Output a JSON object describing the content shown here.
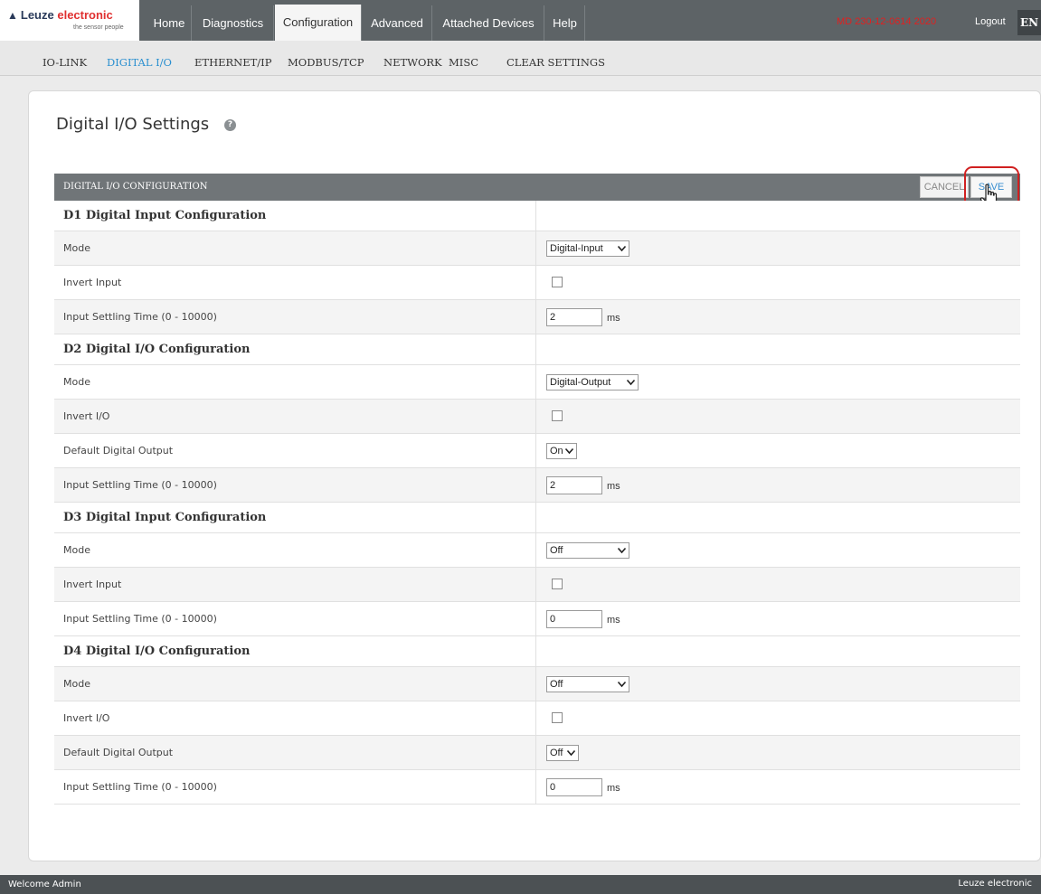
{
  "logo": {
    "brand_prefix": "Leuze ",
    "brand_accent": "electronic",
    "tagline": "the sensor people",
    "icon": "warning-triangle-icon"
  },
  "nav": {
    "tabs": [
      {
        "label": "Home",
        "active": false
      },
      {
        "label": "Diagnostics",
        "active": false
      },
      {
        "label": "Configuration",
        "active": true
      },
      {
        "label": "Advanced",
        "active": false
      },
      {
        "label": "Attached Devices",
        "active": false
      },
      {
        "label": "Help",
        "active": false
      }
    ],
    "serial": "MD 230-12-0614 2020",
    "logout": "Logout",
    "language": "EN"
  },
  "subnav": {
    "items": [
      {
        "label": "IO-LINK",
        "active": false
      },
      {
        "label": "DIGITAL I/O",
        "active": true
      },
      {
        "label": "ETHERNET/IP",
        "active": false
      },
      {
        "label": "MODBUS/TCP",
        "active": false
      },
      {
        "label": "NETWORK",
        "active": false
      },
      {
        "label": "MISC",
        "active": false
      },
      {
        "label": "CLEAR SETTINGS",
        "active": false
      }
    ]
  },
  "page": {
    "title": "Digital I/O Settings",
    "help_icon": "question-circle-icon"
  },
  "table": {
    "header": "DIGITAL I/O CONFIGURATION",
    "cancel_label": "CANCEL",
    "save_label": "SAVE",
    "unit": "ms",
    "sections": [
      {
        "title": "D1 Digital Input Configuration",
        "rows": [
          {
            "label": "Mode",
            "type": "select",
            "value": "Digital-Input"
          },
          {
            "label": "Invert Input",
            "type": "checkbox",
            "checked": false
          },
          {
            "label": "Input Settling Time (0 - 10000)",
            "type": "text",
            "value": "2"
          }
        ]
      },
      {
        "title": "D2 Digital I/O Configuration",
        "rows": [
          {
            "label": "Mode",
            "type": "select",
            "value": "Digital-Output"
          },
          {
            "label": "Invert I/O",
            "type": "checkbox",
            "checked": false
          },
          {
            "label": "Default Digital Output",
            "type": "select",
            "value": "On"
          },
          {
            "label": "Input Settling Time (0 - 10000)",
            "type": "text",
            "value": "2"
          }
        ]
      },
      {
        "title": "D3 Digital Input Configuration",
        "rows": [
          {
            "label": "Mode",
            "type": "select",
            "value": "Off"
          },
          {
            "label": "Invert Input",
            "type": "checkbox",
            "checked": false
          },
          {
            "label": "Input Settling Time (0 - 10000)",
            "type": "text",
            "value": "0"
          }
        ]
      },
      {
        "title": "D4 Digital I/O Configuration",
        "rows": [
          {
            "label": "Mode",
            "type": "select",
            "value": "Off"
          },
          {
            "label": "Invert I/O",
            "type": "checkbox",
            "checked": false
          },
          {
            "label": "Default Digital Output",
            "type": "select",
            "value": "Off"
          },
          {
            "label": "Input Settling Time (0 - 10000)",
            "type": "text",
            "value": "0"
          }
        ]
      }
    ]
  },
  "footer": {
    "welcome": "Welcome Admin",
    "brand": "Leuze electronic"
  },
  "colors": {
    "nav_bg": "#5d6366",
    "active_link": "#2a8fd0",
    "serial": "#e02020",
    "highlight": "#d02020"
  }
}
